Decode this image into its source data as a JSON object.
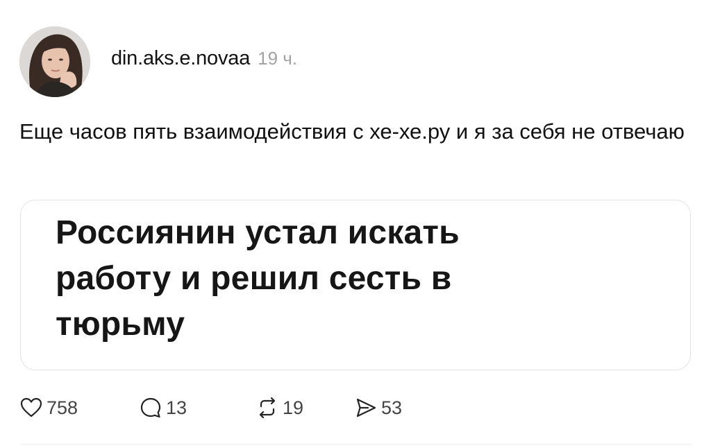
{
  "post": {
    "username": "din.aks.e.novaa",
    "timestamp": "19 ч.",
    "text": "Еще часов пять взаимодействия с хе-хе.ру и я за себя не отвечаю",
    "card": {
      "headline": "Россиянин устал искать работу и решил сесть в тюрьму"
    },
    "actions": {
      "likes": "758",
      "replies": "13",
      "reposts": "19",
      "shares": "53"
    }
  },
  "icons": {
    "like": "heart-icon",
    "reply": "comment-bubble-icon",
    "repost": "repost-icon",
    "share": "send-icon"
  },
  "colors": {
    "text": "#111111",
    "muted": "#a3a3a3",
    "card_border": "#e3e3e3"
  }
}
